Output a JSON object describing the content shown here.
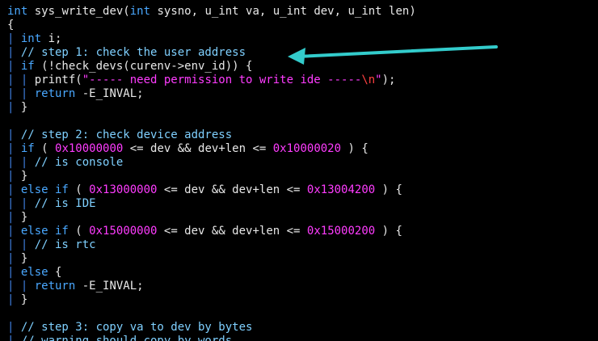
{
  "editor": {
    "language": "c",
    "colors": {
      "background": "#000000",
      "text": "#e8e8e8",
      "keyword": "#4aa8ff",
      "comment": "#7fd0ff",
      "number": "#ff3cff",
      "string": "#ff3cff",
      "escape": "#ff4040",
      "indent_guide": "#3f7fe0",
      "annotation_arrow": "#33cccc"
    },
    "annotation": {
      "type": "arrow",
      "points_to": "// step 1: check the user address",
      "color": "#33cccc"
    },
    "lines": [
      [
        {
          "t": "kw",
          "v": "int"
        },
        {
          "t": "plain",
          "v": " sys_write_dev("
        },
        {
          "t": "kw",
          "v": "int"
        },
        {
          "t": "plain",
          "v": " sysno, u_int va, u_int dev, u_int len)"
        }
      ],
      [
        {
          "t": "plain",
          "v": "{"
        }
      ],
      [
        {
          "t": "guide",
          "v": "| "
        },
        {
          "t": "kw",
          "v": "int"
        },
        {
          "t": "plain",
          "v": " i;"
        }
      ],
      [
        {
          "t": "guide",
          "v": "| "
        },
        {
          "t": "cmt",
          "v": "// step 1: check the user address"
        }
      ],
      [
        {
          "t": "guide",
          "v": "| "
        },
        {
          "t": "kw",
          "v": "if"
        },
        {
          "t": "plain",
          "v": " (!check_devs(curenv->env_id)) {"
        }
      ],
      [
        {
          "t": "guide",
          "v": "| | "
        },
        {
          "t": "plain",
          "v": "printf("
        },
        {
          "t": "str",
          "v": "\"----- need permission to write ide -----"
        },
        {
          "t": "esc",
          "v": "\\n"
        },
        {
          "t": "str",
          "v": "\""
        },
        {
          "t": "plain",
          "v": ");"
        }
      ],
      [
        {
          "t": "guide",
          "v": "| | "
        },
        {
          "t": "kw",
          "v": "return"
        },
        {
          "t": "plain",
          "v": " -E_INVAL;"
        }
      ],
      [
        {
          "t": "guide",
          "v": "| "
        },
        {
          "t": "plain",
          "v": "}"
        }
      ],
      [],
      [
        {
          "t": "guide",
          "v": "| "
        },
        {
          "t": "cmt",
          "v": "// step 2: check device address"
        }
      ],
      [
        {
          "t": "guide",
          "v": "| "
        },
        {
          "t": "kw",
          "v": "if"
        },
        {
          "t": "plain",
          "v": " ( "
        },
        {
          "t": "num",
          "v": "0x10000000"
        },
        {
          "t": "plain",
          "v": " <= dev && dev+len <= "
        },
        {
          "t": "num",
          "v": "0x10000020"
        },
        {
          "t": "plain",
          "v": " ) {"
        }
      ],
      [
        {
          "t": "guide",
          "v": "| | "
        },
        {
          "t": "cmt",
          "v": "// is console"
        }
      ],
      [
        {
          "t": "guide",
          "v": "| "
        },
        {
          "t": "plain",
          "v": "}"
        }
      ],
      [
        {
          "t": "guide",
          "v": "| "
        },
        {
          "t": "kw",
          "v": "else if"
        },
        {
          "t": "plain",
          "v": " ( "
        },
        {
          "t": "num",
          "v": "0x13000000"
        },
        {
          "t": "plain",
          "v": " <= dev && dev+len <= "
        },
        {
          "t": "num",
          "v": "0x13004200"
        },
        {
          "t": "plain",
          "v": " ) {"
        }
      ],
      [
        {
          "t": "guide",
          "v": "| | "
        },
        {
          "t": "cmt",
          "v": "// is IDE"
        }
      ],
      [
        {
          "t": "guide",
          "v": "| "
        },
        {
          "t": "plain",
          "v": "}"
        }
      ],
      [
        {
          "t": "guide",
          "v": "| "
        },
        {
          "t": "kw",
          "v": "else if"
        },
        {
          "t": "plain",
          "v": " ( "
        },
        {
          "t": "num",
          "v": "0x15000000"
        },
        {
          "t": "plain",
          "v": " <= dev && dev+len <= "
        },
        {
          "t": "num",
          "v": "0x15000200"
        },
        {
          "t": "plain",
          "v": " ) {"
        }
      ],
      [
        {
          "t": "guide",
          "v": "| | "
        },
        {
          "t": "cmt",
          "v": "// is rtc"
        }
      ],
      [
        {
          "t": "guide",
          "v": "| "
        },
        {
          "t": "plain",
          "v": "}"
        }
      ],
      [
        {
          "t": "guide",
          "v": "| "
        },
        {
          "t": "kw",
          "v": "else"
        },
        {
          "t": "plain",
          "v": " {"
        }
      ],
      [
        {
          "t": "guide",
          "v": "| | "
        },
        {
          "t": "kw",
          "v": "return"
        },
        {
          "t": "plain",
          "v": " -E_INVAL;"
        }
      ],
      [
        {
          "t": "guide",
          "v": "| "
        },
        {
          "t": "plain",
          "v": "}"
        }
      ],
      [],
      [
        {
          "t": "guide",
          "v": "| "
        },
        {
          "t": "cmt",
          "v": "// step 3: copy va to dev by bytes"
        }
      ],
      [
        {
          "t": "guide",
          "v": "| "
        },
        {
          "t": "cmt",
          "v": "// warning should copy by words"
        }
      ]
    ]
  }
}
